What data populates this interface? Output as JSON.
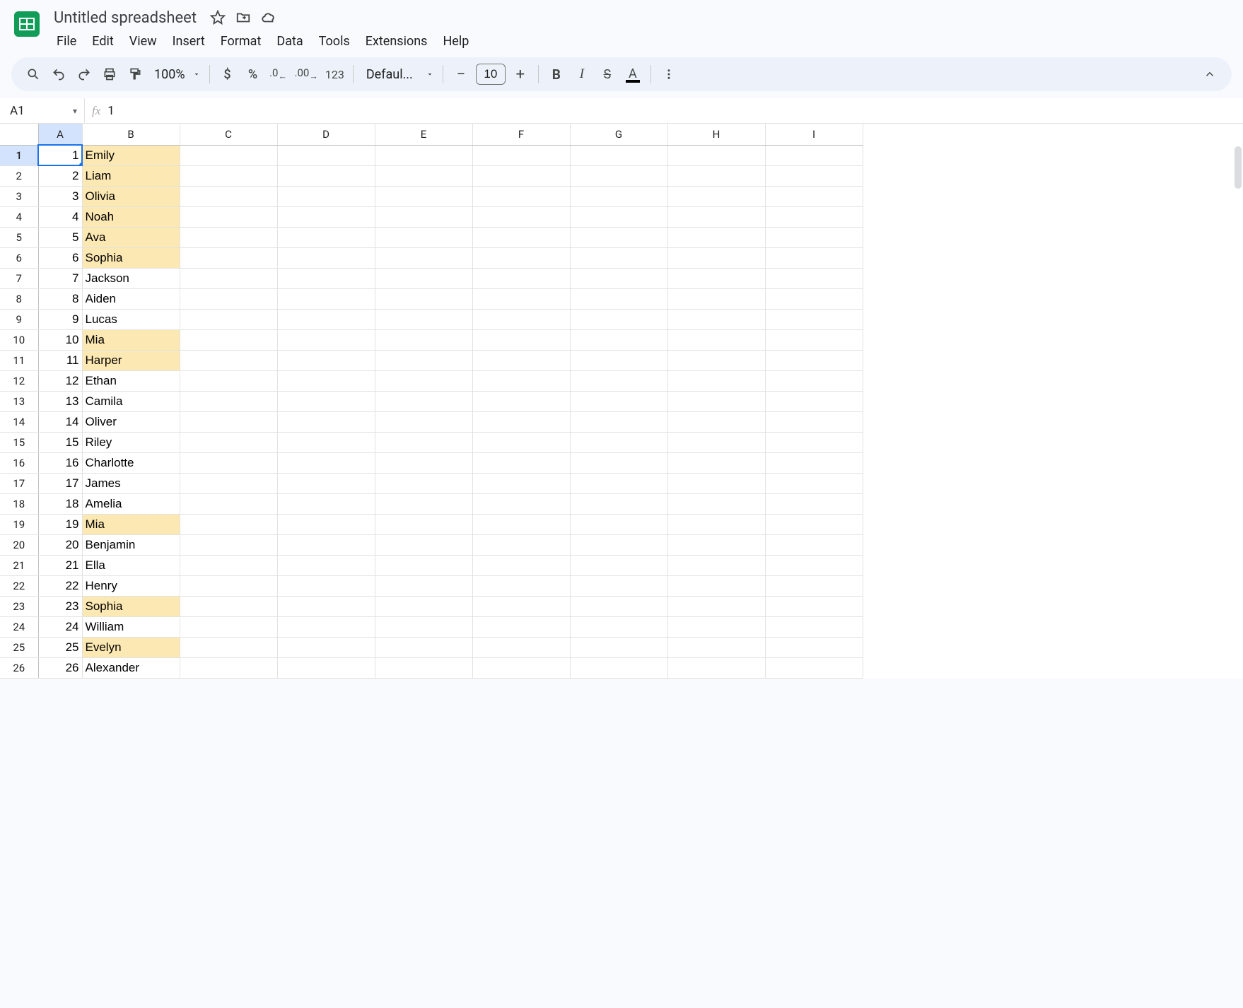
{
  "doc": {
    "title": "Untitled spreadsheet"
  },
  "menubar": [
    "File",
    "Edit",
    "View",
    "Insert",
    "Format",
    "Data",
    "Tools",
    "Extensions",
    "Help"
  ],
  "toolbar": {
    "zoom": "100%",
    "format_123": "123",
    "font_name": "Defaul...",
    "font_size": "10",
    "currency": "$",
    "percent": "%"
  },
  "namebox": {
    "ref": "A1"
  },
  "formula": {
    "fx": "fx",
    "value": "1"
  },
  "columns": [
    "A",
    "B",
    "C",
    "D",
    "E",
    "F",
    "G",
    "H",
    "I"
  ],
  "active": {
    "row": 1,
    "col": "A"
  },
  "rows": [
    {
      "n": 1,
      "a": "1",
      "b": "Emily",
      "hl": true
    },
    {
      "n": 2,
      "a": "2",
      "b": "Liam",
      "hl": true
    },
    {
      "n": 3,
      "a": "3",
      "b": "Olivia",
      "hl": true
    },
    {
      "n": 4,
      "a": "4",
      "b": "Noah",
      "hl": true
    },
    {
      "n": 5,
      "a": "5",
      "b": "Ava",
      "hl": true
    },
    {
      "n": 6,
      "a": "6",
      "b": "Sophia",
      "hl": true
    },
    {
      "n": 7,
      "a": "7",
      "b": "Jackson",
      "hl": false
    },
    {
      "n": 8,
      "a": "8",
      "b": "Aiden",
      "hl": false
    },
    {
      "n": 9,
      "a": "9",
      "b": "Lucas",
      "hl": false
    },
    {
      "n": 10,
      "a": "10",
      "b": "Mia",
      "hl": true
    },
    {
      "n": 11,
      "a": "11",
      "b": "Harper",
      "hl": true
    },
    {
      "n": 12,
      "a": "12",
      "b": "Ethan",
      "hl": false
    },
    {
      "n": 13,
      "a": "13",
      "b": "Camila",
      "hl": false
    },
    {
      "n": 14,
      "a": "14",
      "b": "Oliver",
      "hl": false
    },
    {
      "n": 15,
      "a": "15",
      "b": "Riley",
      "hl": false
    },
    {
      "n": 16,
      "a": "16",
      "b": "Charlotte",
      "hl": false
    },
    {
      "n": 17,
      "a": "17",
      "b": "James",
      "hl": false
    },
    {
      "n": 18,
      "a": "18",
      "b": "Amelia",
      "hl": false
    },
    {
      "n": 19,
      "a": "19",
      "b": "Mia",
      "hl": true
    },
    {
      "n": 20,
      "a": "20",
      "b": "Benjamin",
      "hl": false
    },
    {
      "n": 21,
      "a": "21",
      "b": "Ella",
      "hl": false
    },
    {
      "n": 22,
      "a": "22",
      "b": "Henry",
      "hl": false
    },
    {
      "n": 23,
      "a": "23",
      "b": "Sophia",
      "hl": true
    },
    {
      "n": 24,
      "a": "24",
      "b": "William",
      "hl": false
    },
    {
      "n": 25,
      "a": "25",
      "b": "Evelyn",
      "hl": true
    },
    {
      "n": 26,
      "a": "26",
      "b": "Alexander",
      "hl": false
    }
  ]
}
